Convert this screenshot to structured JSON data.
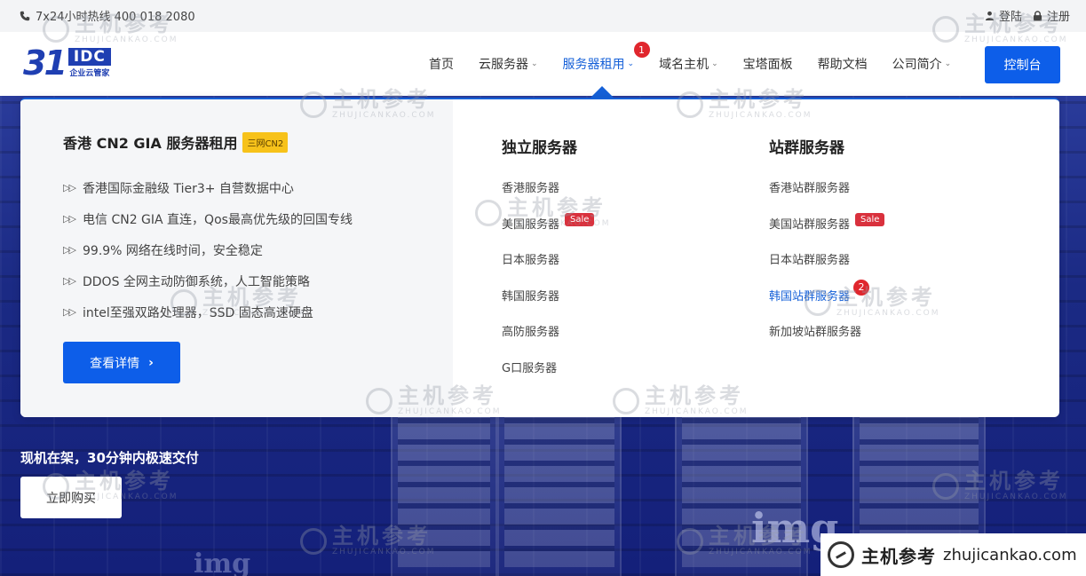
{
  "topbar": {
    "hotline": "7x24小时热线 400 018 2080",
    "login": "登陆",
    "register": "注册"
  },
  "logo": {
    "number": "31",
    "box": "IDC",
    "subtitle": "企业云管家"
  },
  "nav": {
    "items": [
      {
        "label": "首页",
        "has_dropdown": false
      },
      {
        "label": "云服务器",
        "has_dropdown": true
      },
      {
        "label": "服务器租用",
        "has_dropdown": true,
        "active": true
      },
      {
        "label": "域名主机",
        "has_dropdown": true
      },
      {
        "label": "宝塔面板",
        "has_dropdown": false
      },
      {
        "label": "帮助文档",
        "has_dropdown": false
      },
      {
        "label": "公司简介",
        "has_dropdown": true
      }
    ],
    "console_label": "控制台",
    "badge_1": "1"
  },
  "dropdown": {
    "feature": {
      "title": "香港 CN2 GIA 服务器租用",
      "tag": "三网CN2",
      "points": [
        "香港国际金融级 Tier3+ 自营数据中心",
        "电信 CN2 GIA 直连，Qos最高优先级的回国专线",
        "99.9% 网络在线时间，安全稳定",
        "DDOS 全网主动防御系统，人工智能策略",
        "intel至强双路处理器，SSD 固态高速硬盘"
      ],
      "detail_button": "查看详情"
    },
    "dedicated": {
      "title": "独立服务器",
      "links": [
        {
          "label": "香港服务器",
          "sale": ""
        },
        {
          "label": "美国服务器",
          "sale": "Sale"
        },
        {
          "label": "日本服务器",
          "sale": ""
        },
        {
          "label": "韩国服务器",
          "sale": ""
        },
        {
          "label": "高防服务器",
          "sale": ""
        },
        {
          "label": "G口服务器",
          "sale": ""
        }
      ]
    },
    "station": {
      "title": "站群服务器",
      "links": [
        {
          "label": "香港站群服务器",
          "sale": ""
        },
        {
          "label": "美国站群服务器",
          "sale": "Sale"
        },
        {
          "label": "日本站群服务器",
          "sale": ""
        },
        {
          "label": "韩国站群服务器",
          "sale": ""
        },
        {
          "label": "新加坡站群服务器",
          "sale": ""
        }
      ],
      "badge_2": "2"
    }
  },
  "hero": {
    "tagline": "现机在架，30分钟内极速交付",
    "buy_button": "立即购买",
    "brand_text": "img"
  },
  "watermark": {
    "cn": "主机参考",
    "en": "ZHUJICANKAO.COM",
    "corner_cn": "主机参考",
    "corner_url": "zhujicankao.com"
  },
  "colors": {
    "primary": "#0d5ee9",
    "active_nav": "#1560d8",
    "badge_red": "#e0262d",
    "sale_red": "#d9313d",
    "cn2_tag": "#f7c21a",
    "hero_bg": "#1b2a84"
  }
}
